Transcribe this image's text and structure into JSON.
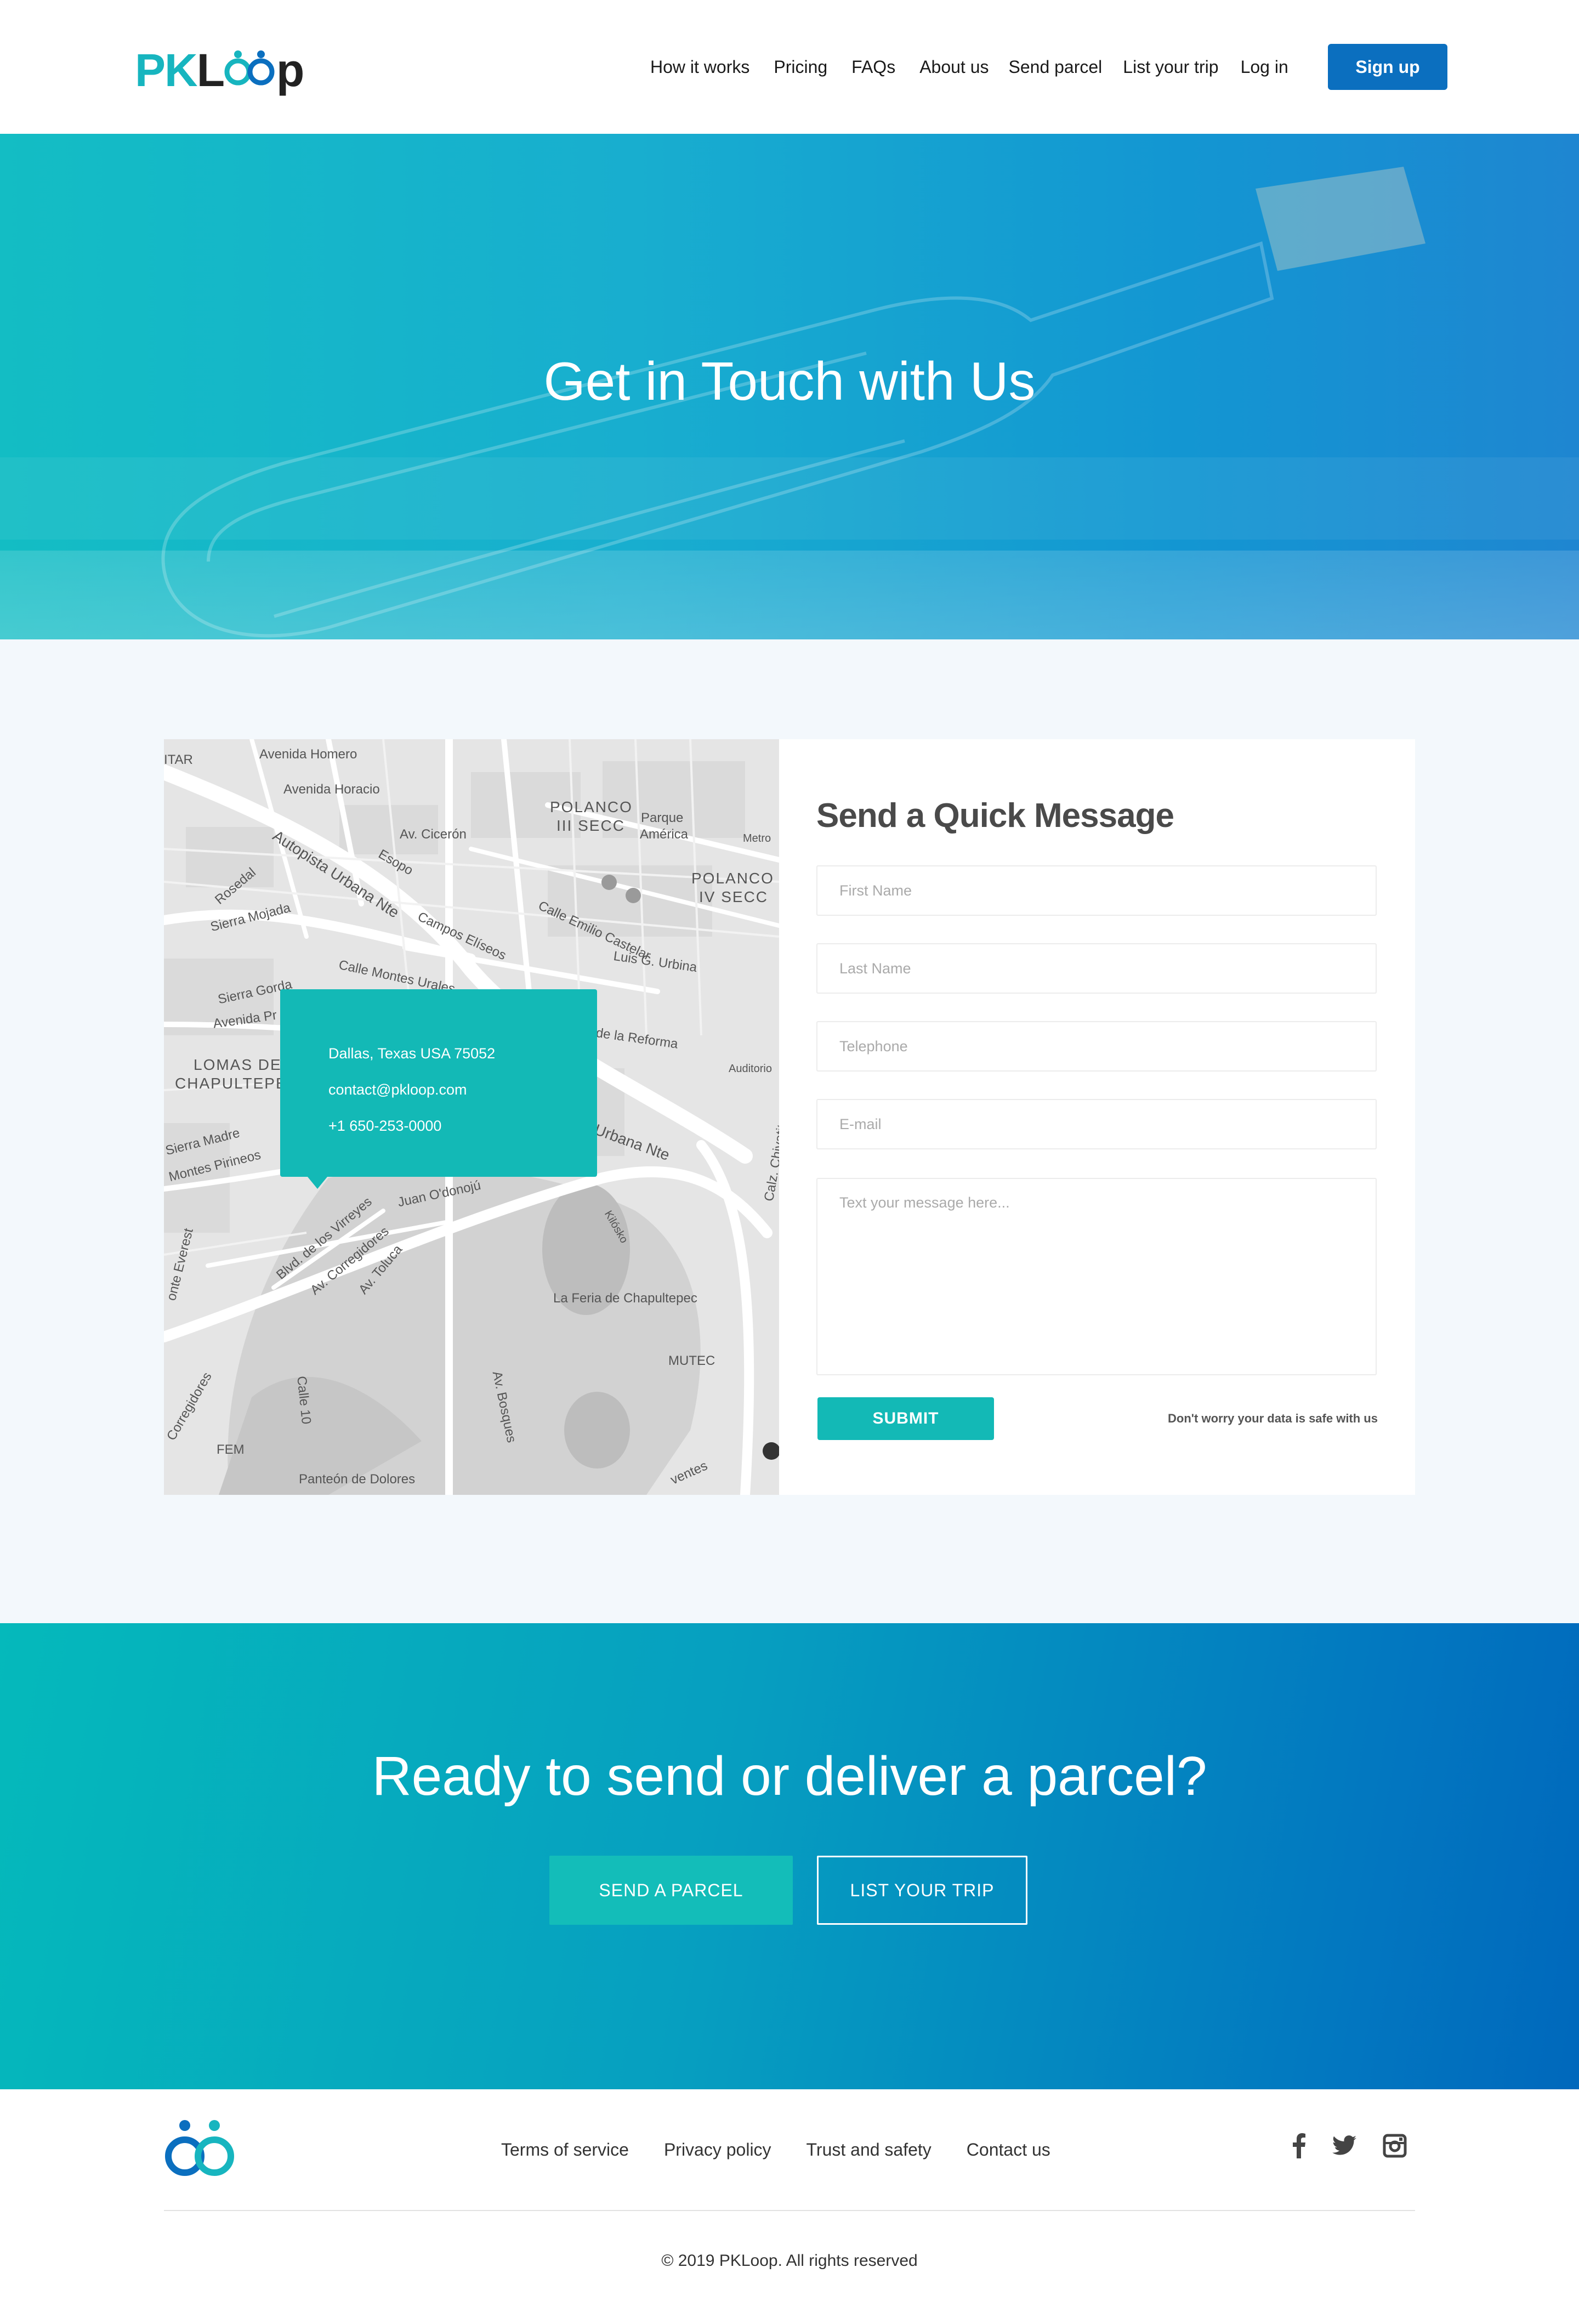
{
  "brand": {
    "prefix": "PK",
    "suffix": "L",
    "rest": "p"
  },
  "nav": {
    "items": [
      "How it works",
      "Pricing",
      "FAQs",
      "About us",
      "Send parcel",
      "List your trip",
      "Log in"
    ],
    "signup": "Sign up"
  },
  "hero": {
    "title": "Get in Touch with Us"
  },
  "map": {
    "address": "Dallas, Texas USA 75052",
    "email": "contact@pkloop.com",
    "phone": "+1 650-253-0000",
    "labels": [
      "Avenida Homero",
      "Avenida Horacio",
      "POLANCO",
      "III SECC",
      "Parque",
      "América",
      "POLANCO",
      "IV SECC",
      "Autopista Urbana Nte",
      "Av. Cicerón",
      "Esopo",
      "Campos Elíseos",
      "Calle Emilio Castelar",
      "Luis G. Urbina",
      "Calle Montes Urales",
      "Sierra Mojada",
      "Rosedal",
      "Sierra Gorda",
      "Avenida Pr",
      "LOMAS DE",
      "CHAPULTEPEC",
      "de la Reforma",
      "Auditorio",
      "Urbana Nte",
      "Sierra Madre",
      "Montes Pirineos",
      "Juan O'donojú",
      "Blvd. de los Virreyes",
      "Av. Corregidores",
      "Av. Toluca",
      "La Feria de Chapultepec",
      "MUTEC",
      "Av. Bosques",
      "Calle 10",
      "FEM",
      "Panteón de Dolores",
      "ITAR",
      "Metro",
      "Kilósko",
      "Calz. Chivatito",
      "onte Everest",
      "Corregidores",
      "ventes"
    ]
  },
  "form": {
    "title": "Send a Quick Message",
    "first_name": "First Name",
    "last_name": "Last Name",
    "telephone": "Telephone",
    "email": "E-mail",
    "message": "Text your message here...",
    "submit": "SUBMIT",
    "note": "Don't worry your data is safe with us"
  },
  "cta": {
    "title": "Ready to send or deliver a parcel?",
    "send": "SEND A PARCEL",
    "list": "LIST YOUR TRIP"
  },
  "footer": {
    "links": [
      "Terms of service",
      "Privacy policy",
      "Trust and safety",
      "Contact us"
    ],
    "copyright": "© 2019 PKLoop. All rights reserved"
  },
  "colors": {
    "teal": "#13b9b6",
    "blue": "#0b6fbf",
    "heading": "#4a4a4a"
  },
  "icons": [
    "facebook-icon",
    "twitter-icon",
    "instagram-icon"
  ]
}
